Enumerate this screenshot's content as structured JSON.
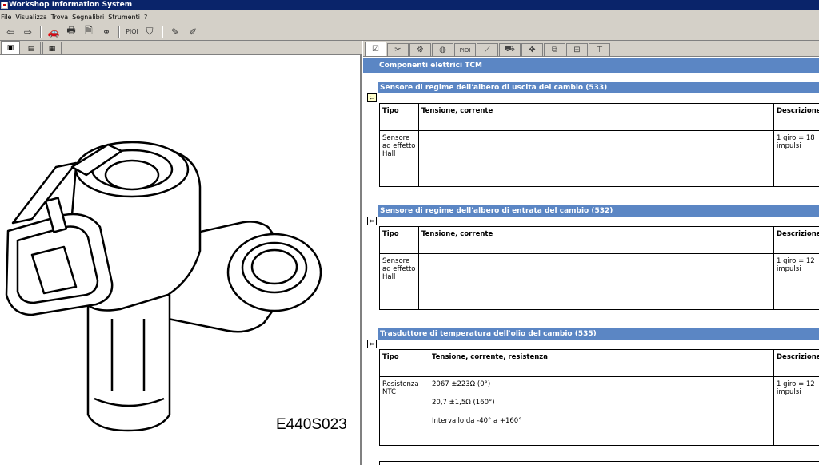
{
  "window": {
    "title": "Workshop Information System"
  },
  "menu": [
    "File",
    "Visualizza",
    "Trova",
    "Segnalibri",
    "Strumenti",
    "?"
  ],
  "toolbar": {
    "buttons": [
      {
        "name": "back-arrow-icon",
        "glyph": "⇦"
      },
      {
        "name": "forward-arrow-icon",
        "glyph": "⇨"
      },
      {
        "name": "car-icon",
        "glyph": "🚗"
      },
      {
        "name": "print-icon",
        "glyph": "🖶"
      },
      {
        "name": "save-icon",
        "glyph": "🗎"
      },
      {
        "name": "binoculars-icon",
        "glyph": "⚭"
      },
      {
        "name": "pi-oi-label",
        "glyph": "PIOI"
      },
      {
        "name": "stamp-icon",
        "glyph": "⛉"
      },
      {
        "name": "pencil-icon",
        "glyph": "✎"
      },
      {
        "name": "note-icon",
        "glyph": "✐"
      }
    ]
  },
  "figure": {
    "label": "E440S023"
  },
  "right_tabs": [
    {
      "name": "tab-specs",
      "glyph": "☑"
    },
    {
      "name": "tab-wrench",
      "glyph": "✂"
    },
    {
      "name": "tab-components",
      "glyph": "⚙"
    },
    {
      "name": "tab-diagnostics",
      "glyph": "◍"
    },
    {
      "name": "tab-pioi",
      "glyph": "PIOI"
    },
    {
      "name": "tab-tools",
      "glyph": "⟋"
    },
    {
      "name": "tab-vehicle",
      "glyph": "⛟"
    },
    {
      "name": "tab-move",
      "glyph": "✥"
    },
    {
      "name": "tab-parts",
      "glyph": "⧉"
    },
    {
      "name": "tab-list",
      "glyph": "⊟"
    },
    {
      "name": "tab-lift",
      "glyph": "⊤"
    }
  ],
  "content": {
    "title": "Componenti elettrici TCM",
    "sections": [
      {
        "title": "Sensore di regime dell'albero di uscita del cambio (533)",
        "col_type": "Tipo",
        "col_value": "Tensione, corrente",
        "col_desc": "Descrizione",
        "type": "Sensore ad effetto Hall",
        "values": [],
        "desc": "1 giro = 18 impulsi"
      },
      {
        "title": "Sensore di regime dell'albero di entrata del cambio (532)",
        "col_type": "Tipo",
        "col_value": "Tensione, corrente",
        "col_desc": "Descrizione",
        "type": "Sensore ad effetto Hall",
        "values": [],
        "desc": "1 giro = 12 impulsi"
      },
      {
        "title": "Trasduttore di temperatura dell'olio del cambio (535)",
        "col_type": "Tipo",
        "col_value": "Tensione, corrente, resistenza",
        "col_desc": "Descrizione",
        "type": "Resistenza NTC",
        "values": [
          "2067 ±223Ω (0°)",
          "20,7 ±1,5Ω (160°)",
          "Intervallo da -40° a +160°"
        ],
        "desc": "1 giro = 12 impulsi"
      }
    ]
  },
  "colors": {
    "title_bar": "#0a246a",
    "section_header": "#5b86c4",
    "chrome": "#d4d0c8"
  }
}
